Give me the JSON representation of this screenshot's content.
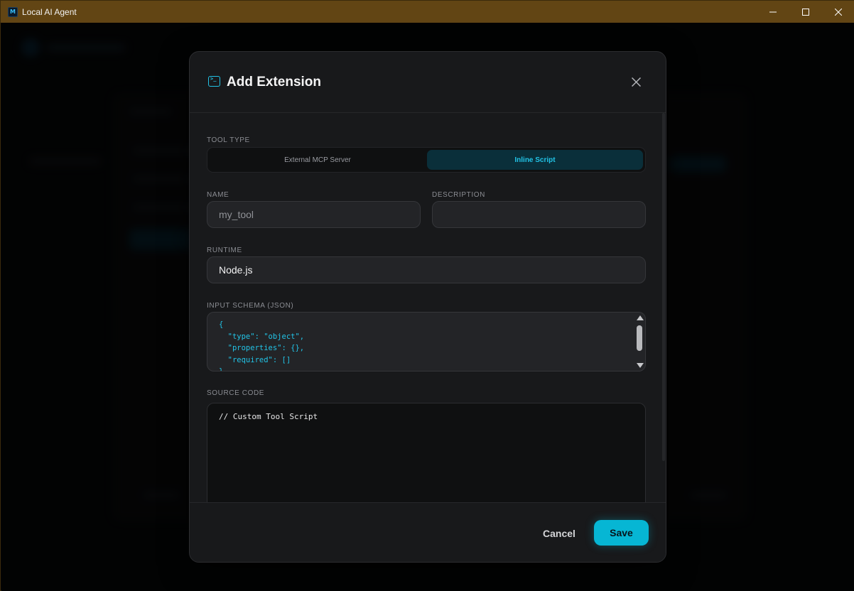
{
  "window": {
    "app_icon_letter": "M",
    "title": "Local AI Agent"
  },
  "modal": {
    "title": "Add Extension",
    "icon": "terminal-icon",
    "tool_type": {
      "label": "TOOL TYPE",
      "options": [
        "External MCP Server",
        "Inline Script"
      ],
      "selected": "Inline Script"
    },
    "name": {
      "label": "NAME",
      "placeholder": "my_tool",
      "value": ""
    },
    "description": {
      "label": "DESCRIPTION",
      "value": ""
    },
    "runtime": {
      "label": "RUNTIME",
      "value": "Node.js"
    },
    "input_schema": {
      "label": "INPUT SCHEMA (JSON)",
      "value": "{\n  \"type\": \"object\",\n  \"properties\": {},\n  \"required\": []\n}"
    },
    "source_code": {
      "label": "SOURCE CODE",
      "value": "// Custom Tool Script"
    },
    "footer": {
      "cancel_label": "Cancel",
      "save_label": "Save"
    }
  },
  "colors": {
    "accent": "#06b6d4",
    "titlebar": "#624514",
    "modal_bg": "#18191b"
  }
}
